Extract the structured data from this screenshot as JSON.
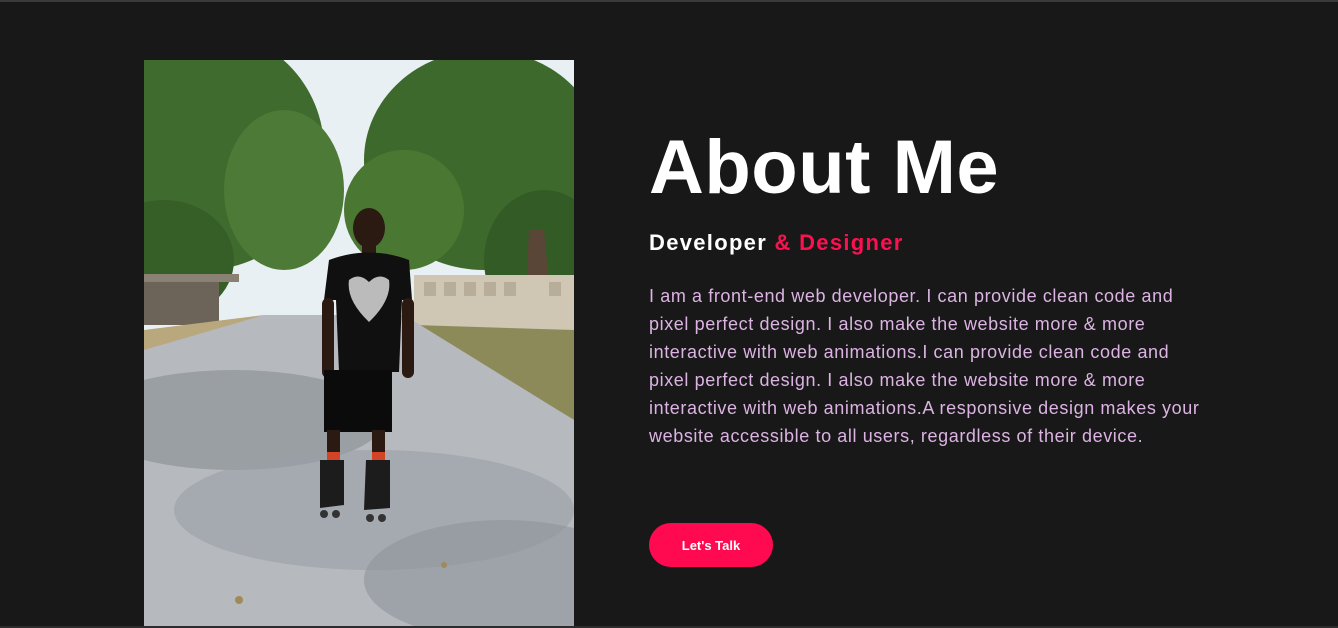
{
  "about": {
    "title": "About Me",
    "role_primary": "Developer",
    "role_accent": "& Designer",
    "bio": "I am a front-end web developer. I can provide clean code and pixel perfect design. I also make the website more & more interactive with web animations.I can provide clean code and pixel perfect design. I also make the website more & more interactive with web animations.A responsive design makes your website accessible to all users, regardless of their device.",
    "cta_label": "Let's Talk"
  },
  "colors": {
    "background": "#181818",
    "accent": "#ff0a50",
    "bio_text": "#dcb3e3",
    "heading": "#ffffff"
  },
  "photo": {
    "subject": "person-on-inline-skates"
  }
}
